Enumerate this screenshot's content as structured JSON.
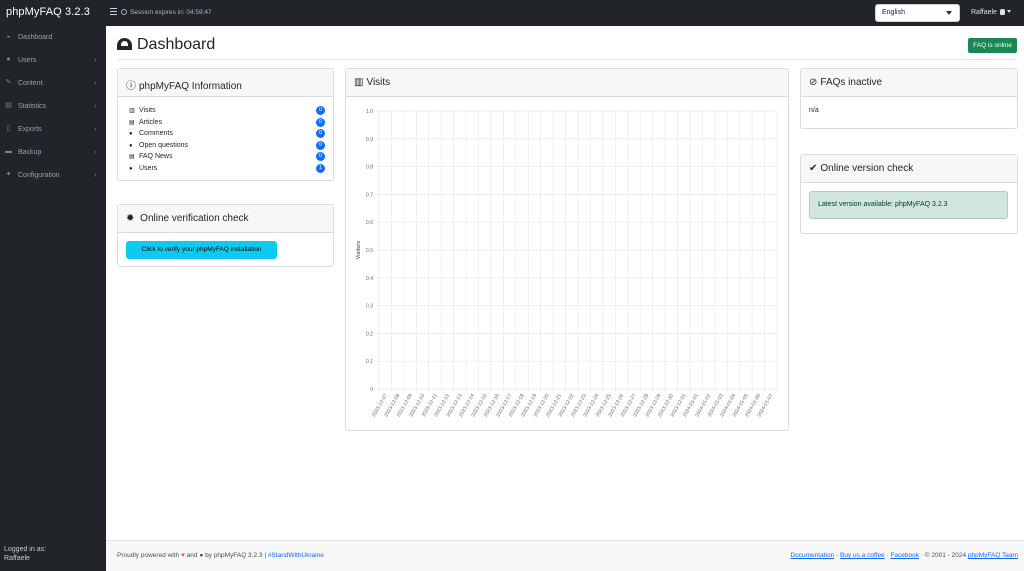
{
  "app": {
    "brand": "phpMyFAQ 3.2.3"
  },
  "topbar": {
    "session_text": "Session expires in: 04:59:47",
    "language": "English",
    "user": "Raffaele"
  },
  "sidebar": {
    "items": [
      {
        "label": "Dashboard",
        "icon": "dashboard-icon",
        "has_submenu": false
      },
      {
        "label": "Users",
        "icon": "users-icon",
        "has_submenu": true
      },
      {
        "label": "Content",
        "icon": "edit-icon",
        "has_submenu": true
      },
      {
        "label": "Statistics",
        "icon": "table-icon",
        "has_submenu": true
      },
      {
        "label": "Exports",
        "icon": "file-icon",
        "has_submenu": true
      },
      {
        "label": "Backup",
        "icon": "download-icon",
        "has_submenu": true
      },
      {
        "label": "Configuration",
        "icon": "wrench-icon",
        "has_submenu": true
      }
    ],
    "logged_in_label": "Logged in as:",
    "logged_in_user": "Raffaele"
  },
  "page": {
    "title": "Dashboard",
    "status_badge": "FAQ is online"
  },
  "info_card": {
    "title": "phpMyFAQ Information",
    "rows": [
      {
        "label": "Visits",
        "count": "0"
      },
      {
        "label": "Articles",
        "count": "0"
      },
      {
        "label": "Comments",
        "count": "0"
      },
      {
        "label": "Open questions",
        "count": "0"
      },
      {
        "label": "FAQ News",
        "count": "0"
      },
      {
        "label": "Users",
        "count": "1"
      }
    ]
  },
  "verify_card": {
    "title": "Online verification check",
    "button": "Click to verify your phpMyFAQ installation"
  },
  "visits_card": {
    "title": "Visits"
  },
  "inactive_card": {
    "title": "FAQs inactive",
    "body": "n/a"
  },
  "version_card": {
    "title": "Online version check",
    "message": "Latest version available: phpMyFAQ 3.2.3"
  },
  "chart_data": {
    "type": "bar",
    "ylabel": "Visitors",
    "ylim": [
      0,
      1
    ],
    "yticks": [
      "0",
      "0.1",
      "0.2",
      "0.3",
      "0.4",
      "0.5",
      "0.6",
      "0.7",
      "0.8",
      "0.9",
      "1.0"
    ],
    "categories": [
      "2023-12-07",
      "2023-12-08",
      "2023-12-09",
      "2023-12-10",
      "2023-12-11",
      "2023-12-12",
      "2023-12-13",
      "2023-12-14",
      "2023-12-15",
      "2023-12-16",
      "2023-12-17",
      "2023-12-18",
      "2023-12-19",
      "2023-12-20",
      "2023-12-21",
      "2023-12-22",
      "2023-12-23",
      "2023-12-24",
      "2023-12-25",
      "2023-12-26",
      "2023-12-27",
      "2023-12-28",
      "2023-12-29",
      "2023-12-30",
      "2023-12-31",
      "2024-01-01",
      "2024-01-02",
      "2024-01-03",
      "2024-01-04",
      "2024-01-05",
      "2024-01-06",
      "2024-01-07"
    ],
    "values": [
      0,
      0,
      0,
      0,
      0,
      0,
      0,
      0,
      0,
      0,
      0,
      0,
      0,
      0,
      0,
      0,
      0,
      0,
      0,
      0,
      0,
      0,
      0,
      0,
      0,
      0,
      0,
      0,
      0,
      0,
      0,
      0
    ],
    "grid": true
  },
  "footer": {
    "powered_prefix": "Proudly powered with",
    "and": "and",
    "by": "by phpMyFAQ 3.2.3 |",
    "hashtag": "#StandWithUkraine",
    "links": [
      "Documentation",
      "Buy us a coffee",
      "Facebook"
    ],
    "copyright": "© 2001 - 2024",
    "team": "phpMyFAQ Team"
  }
}
